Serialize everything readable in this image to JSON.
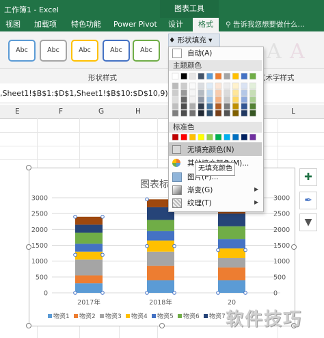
{
  "window": {
    "title": "工作簿1 - Excel",
    "context_title": "图表工具"
  },
  "tabs": [
    "视图",
    "加载项",
    "特色功能",
    "Power Pivot",
    "设计",
    "格式"
  ],
  "tell_me": "告诉我您想要做什么...",
  "ribbon": {
    "abc_label": "Abc",
    "shape_fill_label": "形状填充",
    "group_shape_styles": "形状样式",
    "group_art_styles": "艺术字样式",
    "art_letter": "A"
  },
  "formula": ",Sheet1!$B$1:$D$1,Sheet1!$B$10:$D$10,9)",
  "columns": [
    "E",
    "F",
    "G",
    "H",
    "L"
  ],
  "menu": {
    "auto": "自动(A)",
    "theme_colors": "主题颜色",
    "standard_colors": "标准色",
    "no_fill": "无填充颜色(N)",
    "more_colors": "其他填充颜色(M)...",
    "picture": "图片(P)...",
    "gradient": "渐变(G)",
    "texture": "纹理(T)",
    "tooltip": "无填充颜色",
    "theme_top": [
      "#ffffff",
      "#000000",
      "#e7e6e6",
      "#44546a",
      "#5b9bd5",
      "#ed7d31",
      "#a5a5a5",
      "#ffc000",
      "#4472c4",
      "#70ad47"
    ],
    "standard": [
      "#c00000",
      "#ff0000",
      "#ffc000",
      "#ffff00",
      "#92d050",
      "#00b050",
      "#00b0f0",
      "#0070c0",
      "#002060",
      "#7030a0"
    ]
  },
  "chart_data": {
    "type": "bar",
    "stacked": true,
    "title": "图表标",
    "categories": [
      "2017年",
      "2018年",
      "20"
    ],
    "y_ticks": [
      0,
      500,
      1000,
      1500,
      2000,
      2500,
      3000
    ],
    "ylim": [
      0,
      3000
    ],
    "series": [
      {
        "name": "物资1",
        "color": "#5b9bd5",
        "values": [
          300,
          400,
          400
        ]
      },
      {
        "name": "物资2",
        "color": "#ed7d31",
        "values": [
          250,
          450,
          400
        ]
      },
      {
        "name": "物资3",
        "color": "#a5a5a5",
        "values": [
          500,
          450,
          300
        ]
      },
      {
        "name": "物资4",
        "color": "#ffc000",
        "values": [
          250,
          350,
          300
        ]
      },
      {
        "name": "物资5",
        "color": "#4472c4",
        "values": [
          250,
          300,
          300
        ]
      },
      {
        "name": "物资6",
        "color": "#70ad47",
        "values": [
          350,
          350,
          400
        ]
      },
      {
        "name": "物资7",
        "color": "#264478",
        "values": [
          250,
          400,
          400
        ]
      },
      {
        "name": "",
        "color": "#9e480e",
        "values": [
          250,
          250,
          200
        ]
      }
    ]
  },
  "watermark": "软件技巧"
}
